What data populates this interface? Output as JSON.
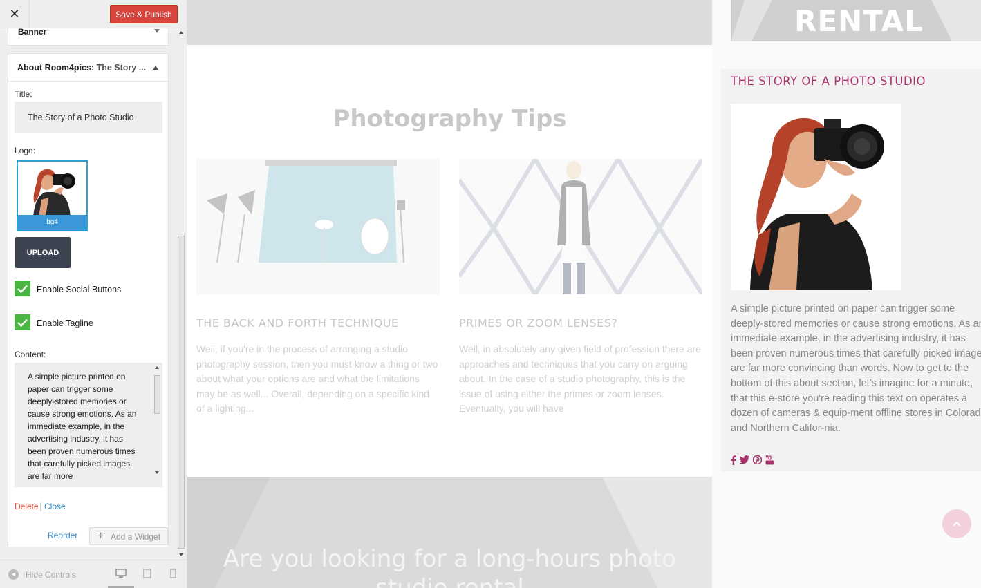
{
  "header": {
    "close_glyph": "✕",
    "save_label": "Save & Publish"
  },
  "widgets": {
    "banner": {
      "title": "Banner"
    },
    "about": {
      "title_main": "About Room4pics:",
      "title_sub": "The Story ...",
      "title_label": "Title:",
      "title_value": "The Story of a Photo Studio",
      "logo_label": "Logo:",
      "logo_caption": "bg4",
      "upload_label": "UPLOAD",
      "social_label": "Enable Social Buttons",
      "social_checked": true,
      "tagline_label": "Enable Tagline",
      "tagline_checked": true,
      "content_label": "Content:",
      "content_value": "A simple picture printed on paper can trigger some deeply-stored memories or cause strong emotions. As an immediate example, in the advertising industry, it has been proven numerous times that carefully picked images are far more",
      "delete_label": "Delete",
      "separator": "|",
      "close_label": "Close"
    }
  },
  "footer_actions": {
    "reorder_label": "Reorder",
    "add_widget_label": "Add a Widget"
  },
  "footer": {
    "hide_controls_label": "Hide Controls",
    "devices": [
      "desktop-icon",
      "tablet-icon",
      "mobile-icon"
    ],
    "active_device": "desktop"
  },
  "preview": {
    "heading": "Photography Tips",
    "posts": [
      {
        "title": "THE BACK AND FORTH TECHNIQUE",
        "excerpt": "Well, if you're in the process of arranging a studio photography session, then you must know a thing or two about what your options are and what the limitations may be as well... Overall, depending on a specific kind of a lighting..."
      },
      {
        "title": "PRIMES OR ZOOM LENSES?",
        "excerpt": "Well, in absolutely any given field of profession there are approaches and techniques that you carry on arguing about. In the case of a studio photography, this is the issue of using either the primes or zoom lenses. Eventually, you will have"
      }
    ],
    "cta": "Are you looking for a long-hours photo studio rental",
    "sidebar": {
      "banner_text": "RENTAL",
      "story_title": "THE STORY OF A PHOTO STUDIO",
      "story_text": "A simple picture printed on paper can trigger some deeply-stored memories or cause strong emotions. As an immediate example, in the advertising industry, it has been proven numerous times that carefully picked images are far more convincing than words. Now to get to the bottom of this about section, let's imagine for a minute, that this e-store you're reading this text on operates a dozen of cameras & equip-ment offline stores in Colorado and Northern Califor-nia.",
      "social_icons": [
        "facebook-icon",
        "twitter-icon",
        "pinterest-icon",
        "youtube-icon"
      ]
    }
  },
  "colors": {
    "accent": "#a8336c",
    "save_button": "#d9443c",
    "check": "#4bb543",
    "link": "#2b85c4",
    "delete": "#e0493a"
  }
}
